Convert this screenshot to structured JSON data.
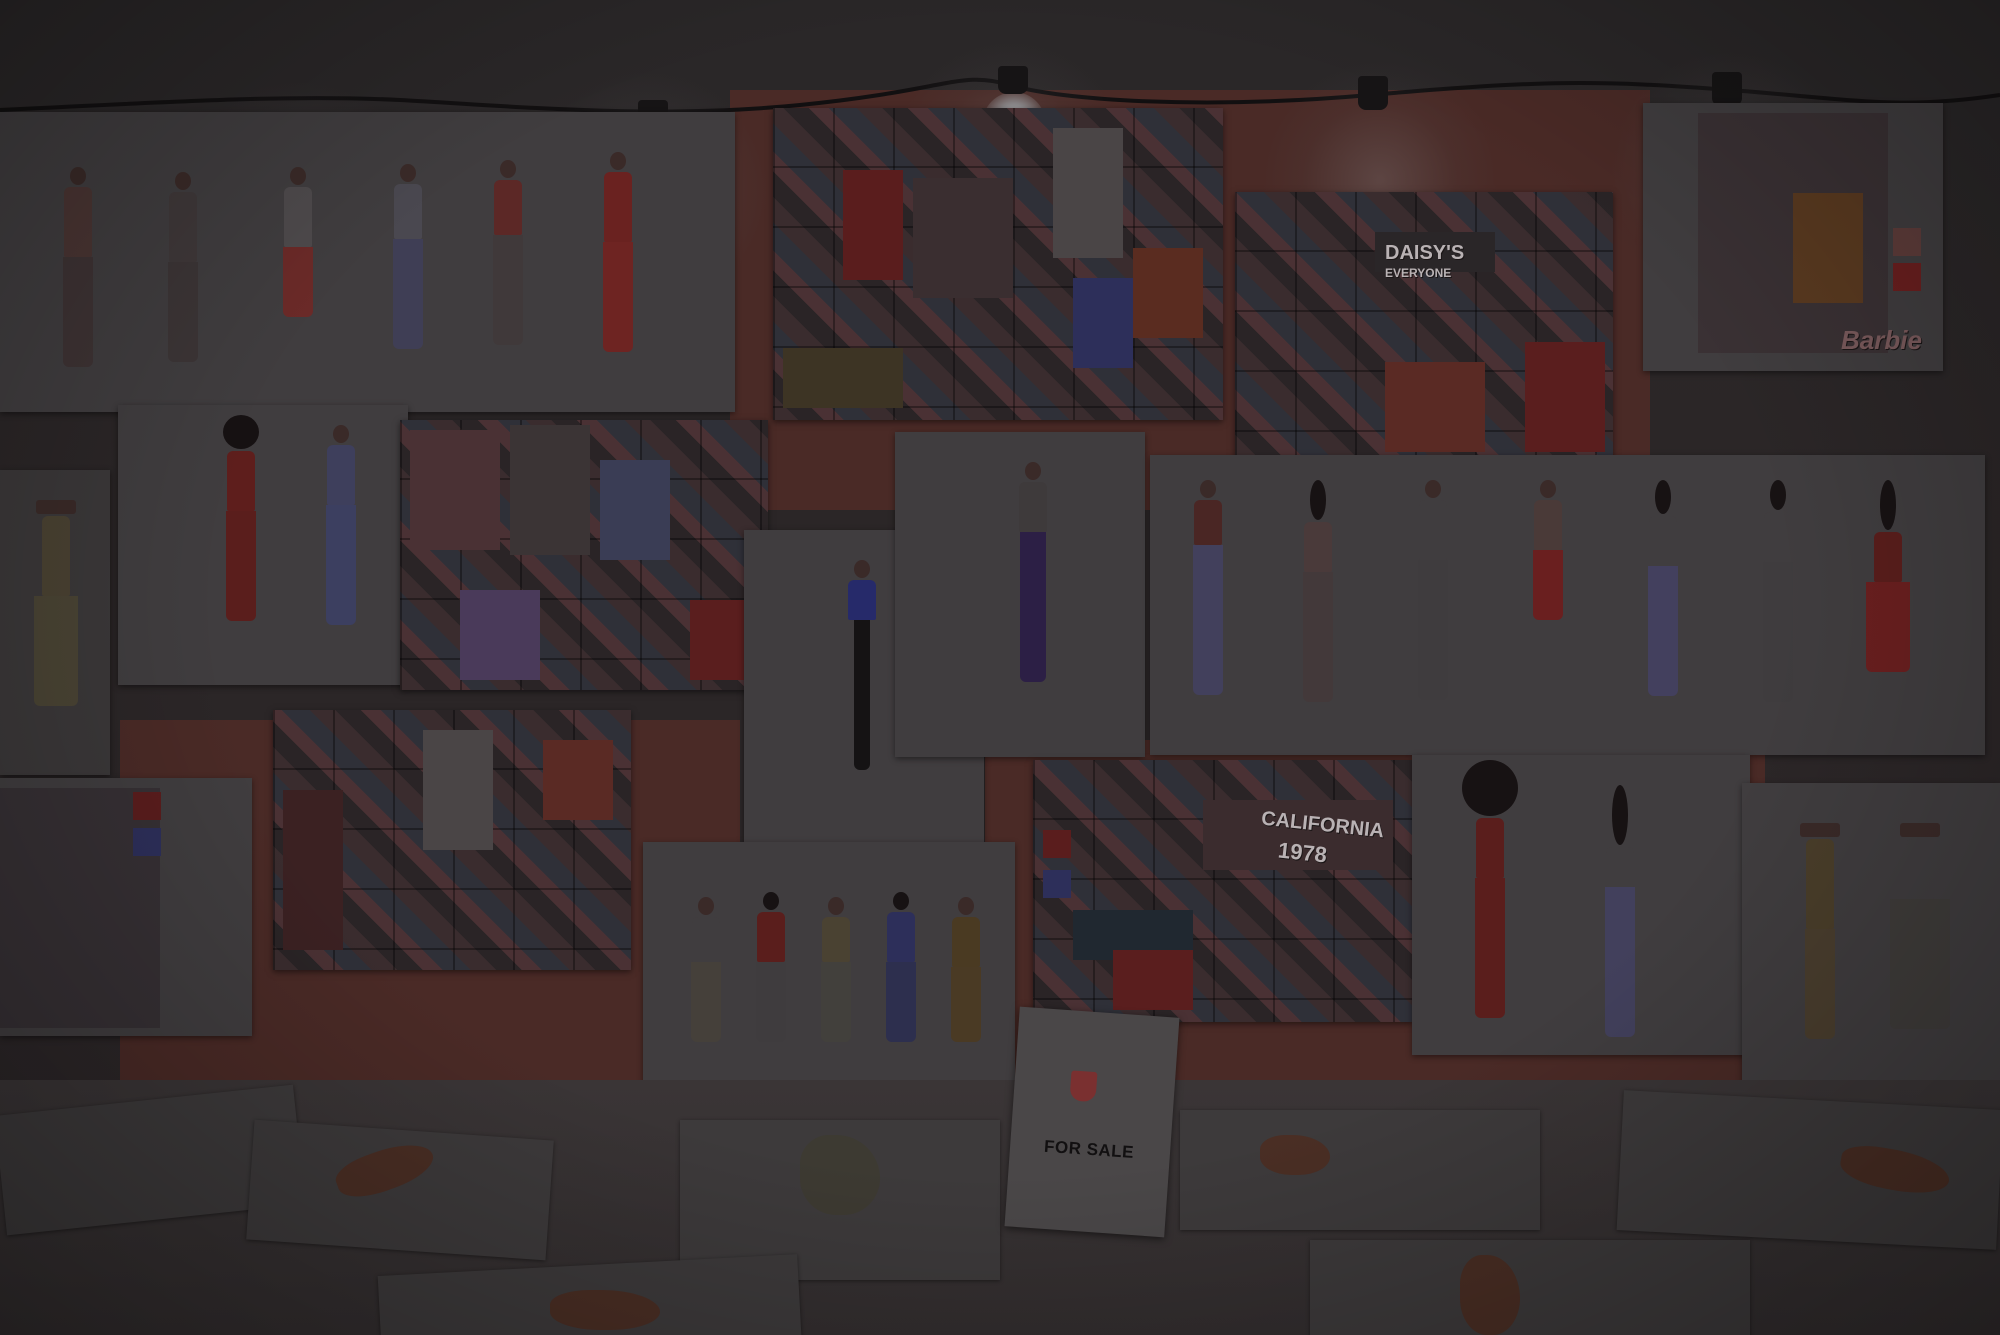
{
  "scene": {
    "description_label": "",
    "for_sale_sign": "FOR SALE",
    "collage_words": {
      "barbie": "Barbie",
      "california": "CALIFORNIA",
      "year": "1978",
      "daisy": "DAISY'S",
      "everyone": "EVERYONE"
    },
    "colors": {
      "board": "#4a2a26",
      "paper": "#3b3839",
      "wall": "#2a2728",
      "accent_red": "#6a1f1f",
      "accent_blue": "#2d2f5a"
    }
  }
}
